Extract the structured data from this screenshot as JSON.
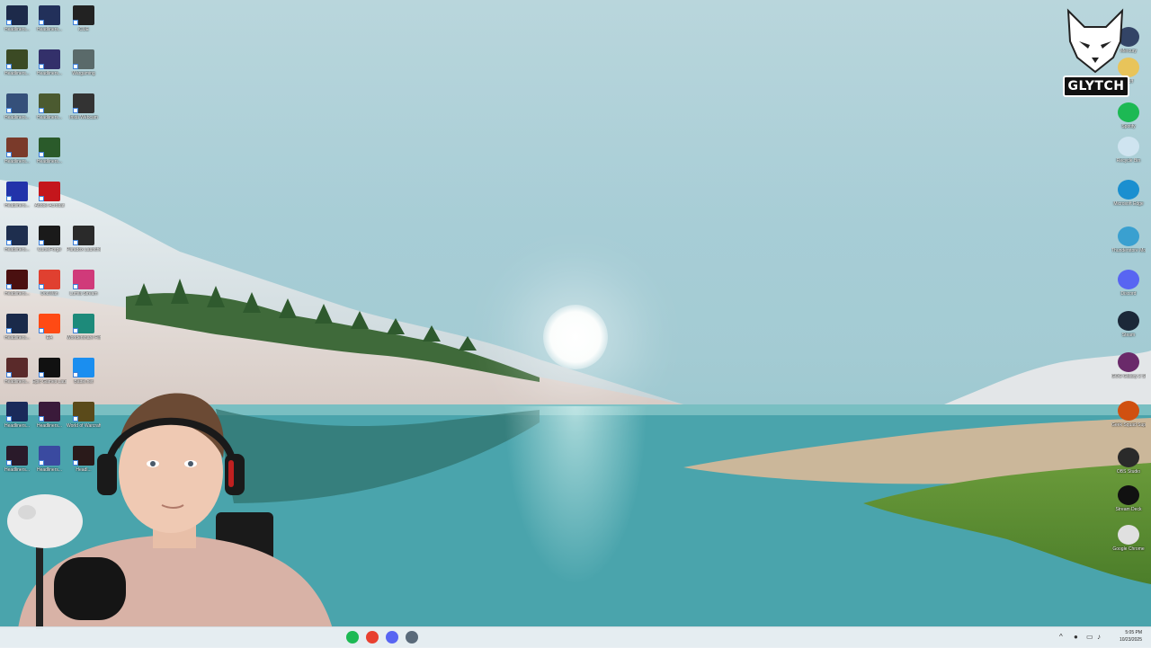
{
  "desktop_icons_left": [
    {
      "label": "Headliners...",
      "color": "#1d2a4a"
    },
    {
      "label": "Headliners...",
      "color": "#22305a"
    },
    {
      "label": "iCUE",
      "color": "#222222"
    },
    {
      "label": "Headliners...",
      "color": "#3b4a24"
    },
    {
      "label": "Headliners...",
      "color": "#33306a"
    },
    {
      "label": "Wargaming",
      "color": "#5a6a6a"
    },
    {
      "label": "Headliners...",
      "color": "#35507a"
    },
    {
      "label": "Headliners...",
      "color": "#4b5a30"
    },
    {
      "label": "Insta Webcam",
      "color": "#333333"
    },
    {
      "label": "Headliners...",
      "color": "#7a3a2a"
    },
    {
      "label": "Headliners...",
      "color": "#2a5a2a"
    },
    {
      "label": "Headliners...",
      "color": "#2233aa"
    },
    {
      "label": "Adobe Acrobat",
      "color": "#c4161c"
    },
    {
      "label": "Headliners...",
      "color": "#1e2e4e"
    },
    {
      "label": "CurseForge",
      "color": "#1a1a1a"
    },
    {
      "label": "Paradox Launcher v2",
      "color": "#2a2a2a"
    },
    {
      "label": "Headliners...",
      "color": "#4a1010"
    },
    {
      "label": "DouWan",
      "color": "#e04030"
    },
    {
      "label": "Lumia Stream",
      "color": "#d03a7a"
    },
    {
      "label": "Headliners...",
      "color": "#1a2a4a"
    },
    {
      "label": "EA",
      "color": "#ff4a14"
    },
    {
      "label": "Wondershare Filmora 14",
      "color": "#1d8a7a"
    },
    {
      "label": "Headliners...",
      "color": "#5a2a2a"
    },
    {
      "label": "Epic Games Launcher",
      "color": "#111111"
    },
    {
      "label": "Battle.net",
      "color": "#1a8ef0"
    },
    {
      "label": "Headliners...",
      "color": "#1a2a5a"
    },
    {
      "label": "Headliners...",
      "color": "#3a1a3a"
    },
    {
      "label": "World of Warcraft",
      "color": "#5a4a1a"
    },
    {
      "label": "Headliners...",
      "color": "#2a1a2a"
    },
    {
      "label": "Headliners...",
      "color": "#3a4aa0"
    },
    {
      "label": "Headl...",
      "color": "#2a1a1a"
    }
  ],
  "desktop_icons_right": [
    {
      "label": "Mercury",
      "color": "#334466"
    },
    {
      "label": "Stuff",
      "color": "#e8c45a"
    },
    {
      "label": "Spotify",
      "color": "#1db954"
    },
    {
      "label": "Recycle Bin",
      "color": "#cfe4f0"
    },
    {
      "label": "Microsoft Edge",
      "color": "#1a8fd0"
    },
    {
      "label": "Thunderstore Mod Manag...",
      "color": "#3aa0d0"
    },
    {
      "label": "Discord",
      "color": "#5865f2"
    },
    {
      "label": "Steam",
      "color": "#1b2838"
    },
    {
      "label": "GOG Galaxy 2 Shortcut",
      "color": "#6a2a6a"
    },
    {
      "label": "Geek Squad Supporthome",
      "color": "#d05010"
    },
    {
      "label": "OBS Studio",
      "color": "#2a2a2a"
    },
    {
      "label": "Stream Deck",
      "color": "#111111"
    },
    {
      "label": "Google Chrome",
      "color": "#e0e0e0"
    }
  ],
  "overlay": {
    "brand": "GLYTCH"
  },
  "taskbar": {
    "apps": [
      {
        "name": "spotify-icon",
        "color": "#1db954"
      },
      {
        "name": "chrome-icon",
        "color": "#e84030"
      },
      {
        "name": "discord-icon",
        "color": "#5865f2"
      },
      {
        "name": "settings-icon",
        "color": "#5a6a7a"
      }
    ],
    "time": "5:05 PM",
    "date": "10/23/2025"
  }
}
